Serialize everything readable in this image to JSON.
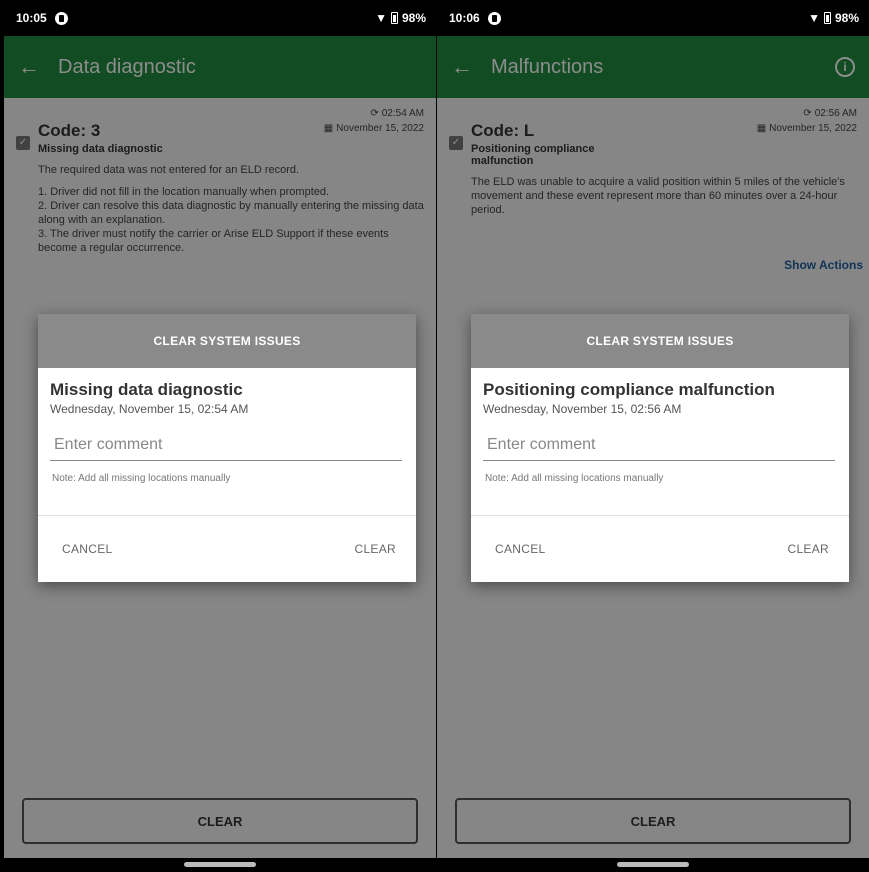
{
  "screens": [
    {
      "status": {
        "time": "10:05",
        "battery": "98%"
      },
      "appbar": {
        "title": "Data diagnostic"
      },
      "card": {
        "code": "Code: 3",
        "subtitle": "Missing data diagnostic",
        "sync": "02:54 AM",
        "date": "November 15, 2022",
        "description_lines": [
          "The required data was not entered for an ELD record.",
          "1. Driver did not fill in the location manually when prompted.",
          "2. Driver can resolve this data diagnostic by manually entering the missing data along with an explanation.",
          "3. The driver must notify the carrier or Arise ELD Support if these events become a regular occurrence."
        ]
      },
      "dialog": {
        "header": "CLEAR SYSTEM ISSUES",
        "title": "Missing data diagnostic",
        "datetime": "Wednesday, November 15, 02:54 AM",
        "comment_placeholder": "Enter comment",
        "note": "Note: Add all missing locations manually",
        "cancel_label": "CANCEL",
        "clear_label": "CLEAR"
      },
      "bottom_button": "CLEAR"
    },
    {
      "status": {
        "time": "10:06",
        "battery": "98%"
      },
      "appbar": {
        "title": "Malfunctions"
      },
      "card": {
        "code": "Code: L",
        "subtitle": "Positioning compliance malfunction",
        "sync": "02:56 AM",
        "date": "November 15, 2022",
        "description_lines": [
          "The ELD was unable to acquire a valid position within 5 miles of the vehicle's movement and these event represent more than 60 minutes over a 24-hour period."
        ],
        "show_actions": "Show Actions"
      },
      "dialog": {
        "header": "CLEAR SYSTEM ISSUES",
        "title": "Positioning compliance malfunction",
        "datetime": "Wednesday, November 15, 02:56 AM",
        "comment_placeholder": "Enter comment",
        "note": "Note: Add all missing locations manually",
        "cancel_label": "CANCEL",
        "clear_label": "CLEAR"
      },
      "bottom_button": "CLEAR"
    }
  ],
  "colors": {
    "appbar": "#1f8a3f",
    "dialog_header": "#8a8a8a"
  },
  "icons": [
    "back-arrow-icon",
    "info-icon",
    "sync-icon",
    "calendar-icon",
    "checkbox-icon",
    "wifi-icon",
    "battery-icon"
  ]
}
